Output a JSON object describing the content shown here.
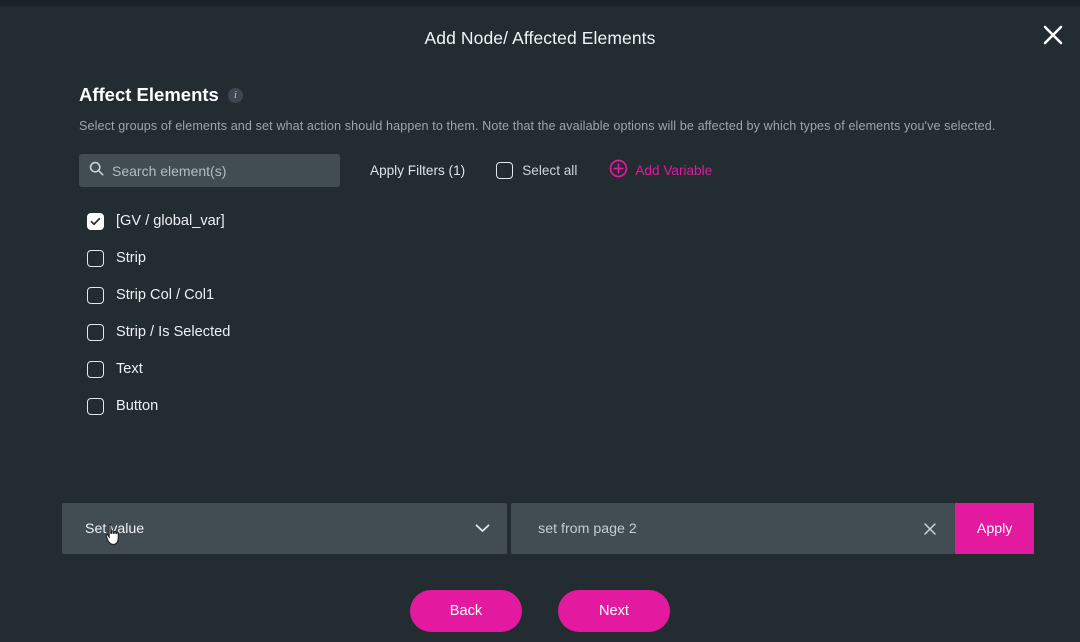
{
  "modal": {
    "title": "Add Node/ Affected Elements",
    "close_icon": "close-icon"
  },
  "section": {
    "title": "Affect Elements",
    "info_icon": "i",
    "description": "Select groups of elements and set what action should happen to them. Note that the available options will be affected by which types of elements you've selected."
  },
  "toolbar": {
    "search_placeholder": "Search element(s)",
    "search_value": "",
    "apply_filters_label": "Apply Filters (1)",
    "select_all_label": "Select all",
    "select_all_checked": false,
    "add_variable_label": "Add Variable"
  },
  "elements": [
    {
      "label": "[GV / global_var]",
      "checked": true
    },
    {
      "label": "Strip",
      "checked": false
    },
    {
      "label": "Strip Col / Col1",
      "checked": false
    },
    {
      "label": "Strip / Is Selected",
      "checked": false
    },
    {
      "label": "Text",
      "checked": false
    },
    {
      "label": "Button",
      "checked": false
    }
  ],
  "action_bar": {
    "action_selected": "Set value",
    "action_options": [
      "Set value"
    ],
    "value_text": "set from page 2",
    "apply_label": "Apply"
  },
  "footer": {
    "back_label": "Back",
    "next_label": "Next"
  },
  "colors": {
    "accent": "#e3199f",
    "background": "#232c31",
    "field": "#414d53",
    "top_strip": "#1b2327"
  }
}
